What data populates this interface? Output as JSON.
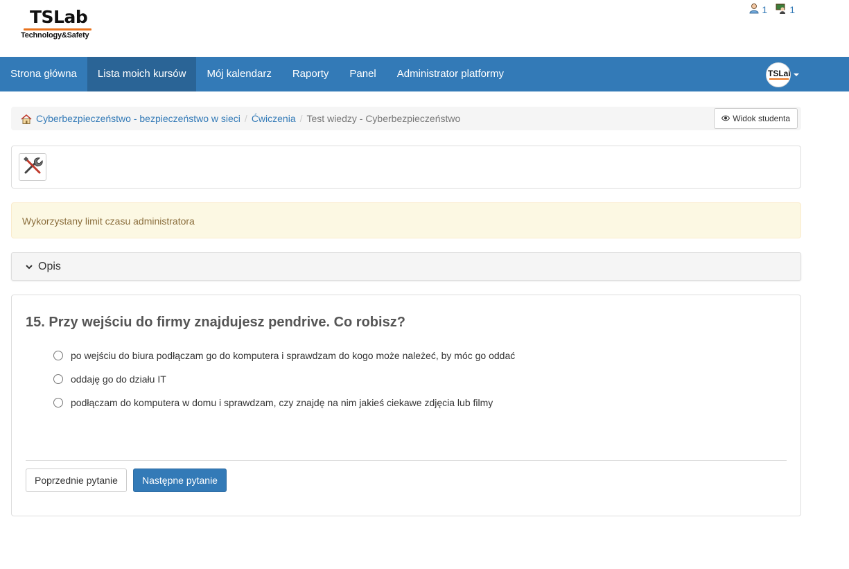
{
  "logo": {
    "main": "TSLab",
    "sub": "Technology&Safety"
  },
  "top_counters": {
    "users_count": "1",
    "teachers_count": "1"
  },
  "nav": {
    "items": [
      {
        "label": "Strona główna",
        "active": false
      },
      {
        "label": "Lista moich kursów",
        "active": true
      },
      {
        "label": "Mój kalendarz",
        "active": false
      },
      {
        "label": "Raporty",
        "active": false
      },
      {
        "label": "Panel",
        "active": false
      },
      {
        "label": "Administrator platformy",
        "active": false
      }
    ],
    "avatar_text": "TSLab"
  },
  "breadcrumb": {
    "course": "Cyberbezpieczeństwo - bezpieczeństwo w sieci",
    "section": "Ćwiczenia",
    "current": "Test wiedzy - Cyberbezpieczeństwo",
    "student_view_label": "Widok studenta"
  },
  "alert": {
    "text": "Wykorzystany limit czasu administratora"
  },
  "description": {
    "label": "Opis"
  },
  "question": {
    "title": "15. Przy wejściu do firmy znajdujesz pendrive. Co robisz?",
    "answers": [
      "po wejściu do biura podłączam go do komputera i sprawdzam do kogo może należeć, by móc go oddać",
      "oddaję go do działu IT",
      "podłączam do komputera w domu i sprawdzam, czy znajdę na nim jakieś ciekawe zdjęcia lub filmy"
    ],
    "prev_label": "Poprzednie pytanie",
    "next_label": "Następne pytanie"
  },
  "colors": {
    "primary": "#337ab7",
    "primary_dark": "#2a6496",
    "alert_bg": "#fcf8e3",
    "alert_text": "#8a6d3b",
    "logo_accent": "#e8731e"
  },
  "icons": {
    "user": "user-icon",
    "teacher": "teacher-icon",
    "home": "home-icon",
    "eye": "eye-icon",
    "tools": "tools-icon",
    "chevron": "chevron-down-icon"
  }
}
